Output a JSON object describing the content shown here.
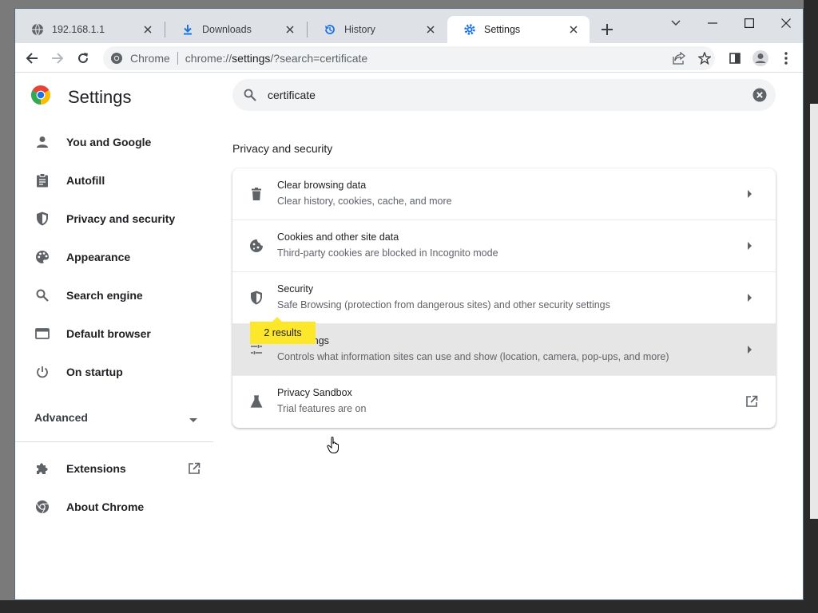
{
  "tabs": [
    {
      "title": "192.168.1.1",
      "icon": "globe-icon"
    },
    {
      "title": "Downloads",
      "icon": "download-icon"
    },
    {
      "title": "History",
      "icon": "history-icon"
    },
    {
      "title": "Settings",
      "icon": "gear-icon",
      "active": true
    }
  ],
  "omnibox": {
    "site_chip": "Chrome",
    "url_scheme": "chrome://",
    "url_host": "settings",
    "url_rest": "/?search=certificate"
  },
  "sidebar": {
    "title": "Settings",
    "items": [
      {
        "label": "You and Google",
        "icon": "person-icon"
      },
      {
        "label": "Autofill",
        "icon": "clipboard-icon"
      },
      {
        "label": "Privacy and security",
        "icon": "shield-icon"
      },
      {
        "label": "Appearance",
        "icon": "palette-icon"
      },
      {
        "label": "Search engine",
        "icon": "search-icon"
      },
      {
        "label": "Default browser",
        "icon": "browser-icon"
      },
      {
        "label": "On startup",
        "icon": "power-icon"
      }
    ],
    "advanced_label": "Advanced",
    "extensions_label": "Extensions",
    "about_label": "About Chrome"
  },
  "search": {
    "value": "certificate"
  },
  "main": {
    "section_title": "Privacy and security",
    "results_badge": "2 results",
    "rows": [
      {
        "title": "Clear browsing data",
        "subtitle": "Clear history, cookies, cache, and more",
        "icon": "trash-icon"
      },
      {
        "title": "Cookies and other site data",
        "subtitle": "Third-party cookies are blocked in Incognito mode",
        "icon": "cookie-icon"
      },
      {
        "title": "Security",
        "subtitle": "Safe Browsing (protection from dangerous sites) and other security settings",
        "icon": "shield-icon"
      },
      {
        "title": "Site Settings",
        "title_visible": "ings",
        "subtitle": "Controls what information sites can use and show (location, camera, pop-ups, and more)",
        "icon": "tune-icon"
      },
      {
        "title": "Privacy Sandbox",
        "subtitle": "Trial features are on",
        "icon": "flask-icon"
      }
    ]
  },
  "colors": {
    "accent": "#1a73e8",
    "highlight": "#fde72b",
    "tabstrip": "#dee1e6"
  }
}
